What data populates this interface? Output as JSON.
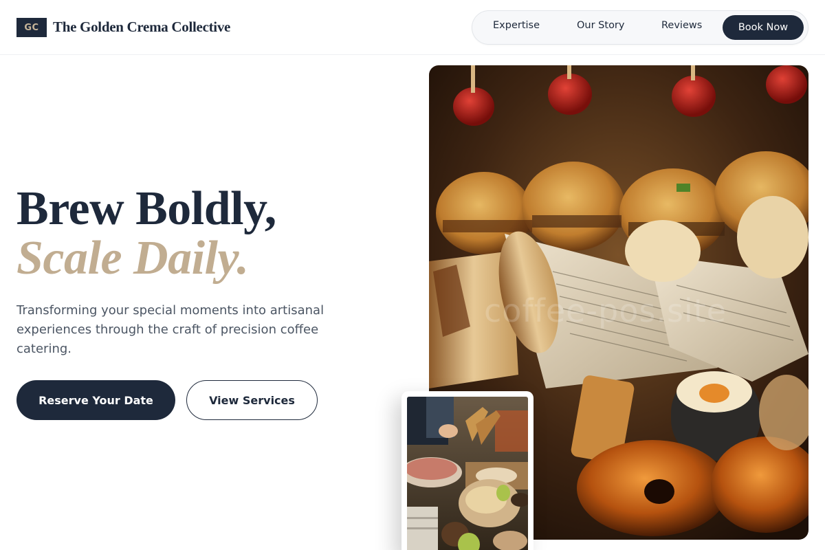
{
  "brand": {
    "initials": "GC",
    "name": "The Golden Crema Collective"
  },
  "nav": {
    "items": [
      {
        "label": "Expertise"
      },
      {
        "label": "Our Story"
      },
      {
        "label": "Reviews"
      }
    ],
    "cta_label": "Book Now"
  },
  "hero": {
    "title_line1": "Brew Boldly,",
    "title_line2": "Scale Daily.",
    "description": "Transforming your special moments into artisanal experiences through the craft of precision coffee catering.",
    "primary_button": "Reserve Your Date",
    "secondary_button": "View Services"
  },
  "main_image": {
    "watermark": "coffee-pos.site"
  },
  "colors": {
    "navy": "#1e293b",
    "gold": "#c1ad91",
    "body_text": "#4b5563"
  }
}
